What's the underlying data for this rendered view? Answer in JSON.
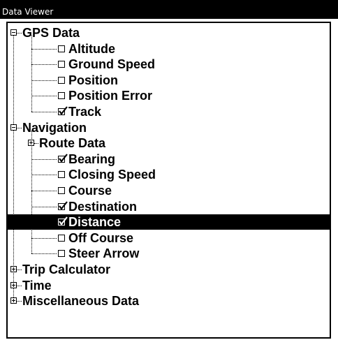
{
  "window": {
    "title": "Data Viewer"
  },
  "tree": {
    "selected": "Distance",
    "nodes": [
      {
        "key": "gps",
        "label": "GPS Data",
        "level": 0,
        "type": "group",
        "expanded": true
      },
      {
        "key": "altitude",
        "label": "Altitude",
        "level": 1,
        "type": "item",
        "checked": false
      },
      {
        "key": "ground-speed",
        "label": "Ground Speed",
        "level": 1,
        "type": "item",
        "checked": false
      },
      {
        "key": "position",
        "label": "Position",
        "level": 1,
        "type": "item",
        "checked": false
      },
      {
        "key": "position-error",
        "label": "Position Error",
        "level": 1,
        "type": "item",
        "checked": false
      },
      {
        "key": "track",
        "label": "Track",
        "level": 1,
        "type": "item",
        "checked": true
      },
      {
        "key": "navigation",
        "label": "Navigation",
        "level": 0,
        "type": "group",
        "expanded": true
      },
      {
        "key": "route-data",
        "label": "Route Data",
        "level": 1,
        "type": "group",
        "expanded": false
      },
      {
        "key": "bearing",
        "label": "Bearing",
        "level": 1,
        "type": "item",
        "checked": true
      },
      {
        "key": "closing-speed",
        "label": "Closing Speed",
        "level": 1,
        "type": "item",
        "checked": false
      },
      {
        "key": "course",
        "label": "Course",
        "level": 1,
        "type": "item",
        "checked": false
      },
      {
        "key": "destination",
        "label": "Destination",
        "level": 1,
        "type": "item",
        "checked": true
      },
      {
        "key": "distance",
        "label": "Distance",
        "level": 1,
        "type": "item",
        "checked": true,
        "selected": true
      },
      {
        "key": "off-course",
        "label": "Off Course",
        "level": 1,
        "type": "item",
        "checked": false
      },
      {
        "key": "steer-arrow",
        "label": "Steer Arrow",
        "level": 1,
        "type": "item",
        "checked": false
      },
      {
        "key": "trip-calculator",
        "label": "Trip Calculator",
        "level": 0,
        "type": "group",
        "expanded": false
      },
      {
        "key": "time",
        "label": "Time",
        "level": 0,
        "type": "group",
        "expanded": false
      },
      {
        "key": "misc",
        "label": "Miscellaneous Data",
        "level": 0,
        "type": "group",
        "expanded": false
      }
    ]
  },
  "colors": {
    "selection_bg": "#000000",
    "selection_fg": "#ffffff",
    "text": "#000000",
    "background": "#ffffff"
  }
}
